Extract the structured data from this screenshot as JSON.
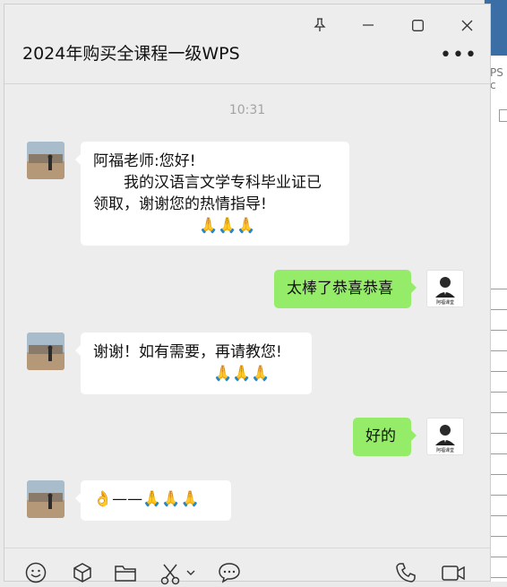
{
  "window": {
    "title": "2024年购买全课程一级WPS",
    "controls": [
      "pin-icon",
      "minimize-icon",
      "maximize-icon",
      "close-icon"
    ],
    "more_label": "•••"
  },
  "chat": {
    "timestamp": "10:31",
    "messages": [
      {
        "side": "left",
        "lines": [
          "阿福老师:您好!",
          "　　我的汉语言文学专科毕业证已",
          "领取，谢谢您的热情指导!"
        ],
        "emoji": "🙏🙏🙏"
      },
      {
        "side": "right",
        "text": "太棒了恭喜恭喜"
      },
      {
        "side": "left",
        "lines": [
          "谢谢！如有需要，再请教您!"
        ],
        "emoji": "🙏🙏🙏"
      },
      {
        "side": "right",
        "text": "好的"
      },
      {
        "side": "left",
        "text": "👌——🙏🙏🙏"
      }
    ],
    "avatar_label": "阿福课堂"
  },
  "background_window": {
    "partial_text": "PS c"
  },
  "toolbar": {
    "icons": [
      "emoji-icon",
      "box-icon",
      "folder-icon",
      "scissors-icon",
      "chevron-down-icon",
      "chat-bubble-icon",
      "phone-icon",
      "video-icon"
    ]
  },
  "colors": {
    "bubble_self": "#95ec69",
    "bubble_other": "#ffffff",
    "background": "#ededed"
  }
}
